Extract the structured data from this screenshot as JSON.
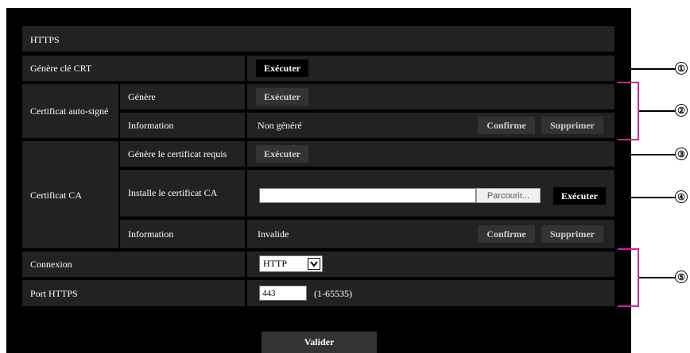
{
  "title": "HTTPS",
  "rows": {
    "gen_key": {
      "label": "Génère clé CRT",
      "button": "Exécuter"
    },
    "self_signed": {
      "label": "Certificat auto-signé",
      "generate": {
        "label": "Génère",
        "button": "Exécuter"
      },
      "info": {
        "label": "Information",
        "value": "Non généré",
        "confirm": "Confirme",
        "delete": "Supprimer"
      }
    },
    "ca": {
      "label": "Certificat CA",
      "request": {
        "label": "Génère le certificat requis",
        "button": "Exécuter"
      },
      "install": {
        "label": "Installe le certificat CA",
        "file_value": "",
        "browse": "Parcourir...",
        "button": "Exécuter"
      },
      "info": {
        "label": "Information",
        "value": "Invalide",
        "confirm": "Confirme",
        "delete": "Supprimer"
      }
    },
    "connection": {
      "label": "Connexion",
      "value": "HTTP"
    },
    "port": {
      "label": "Port HTTPS",
      "value": "443",
      "range": "(1-65535)"
    }
  },
  "submit": "Valider",
  "callouts": [
    "①",
    "②",
    "③",
    "④",
    "⑤"
  ],
  "colors": {
    "panel": "#000000",
    "cell": "#222222",
    "bracket": "#d6219b",
    "disabled_button": "#333333"
  }
}
